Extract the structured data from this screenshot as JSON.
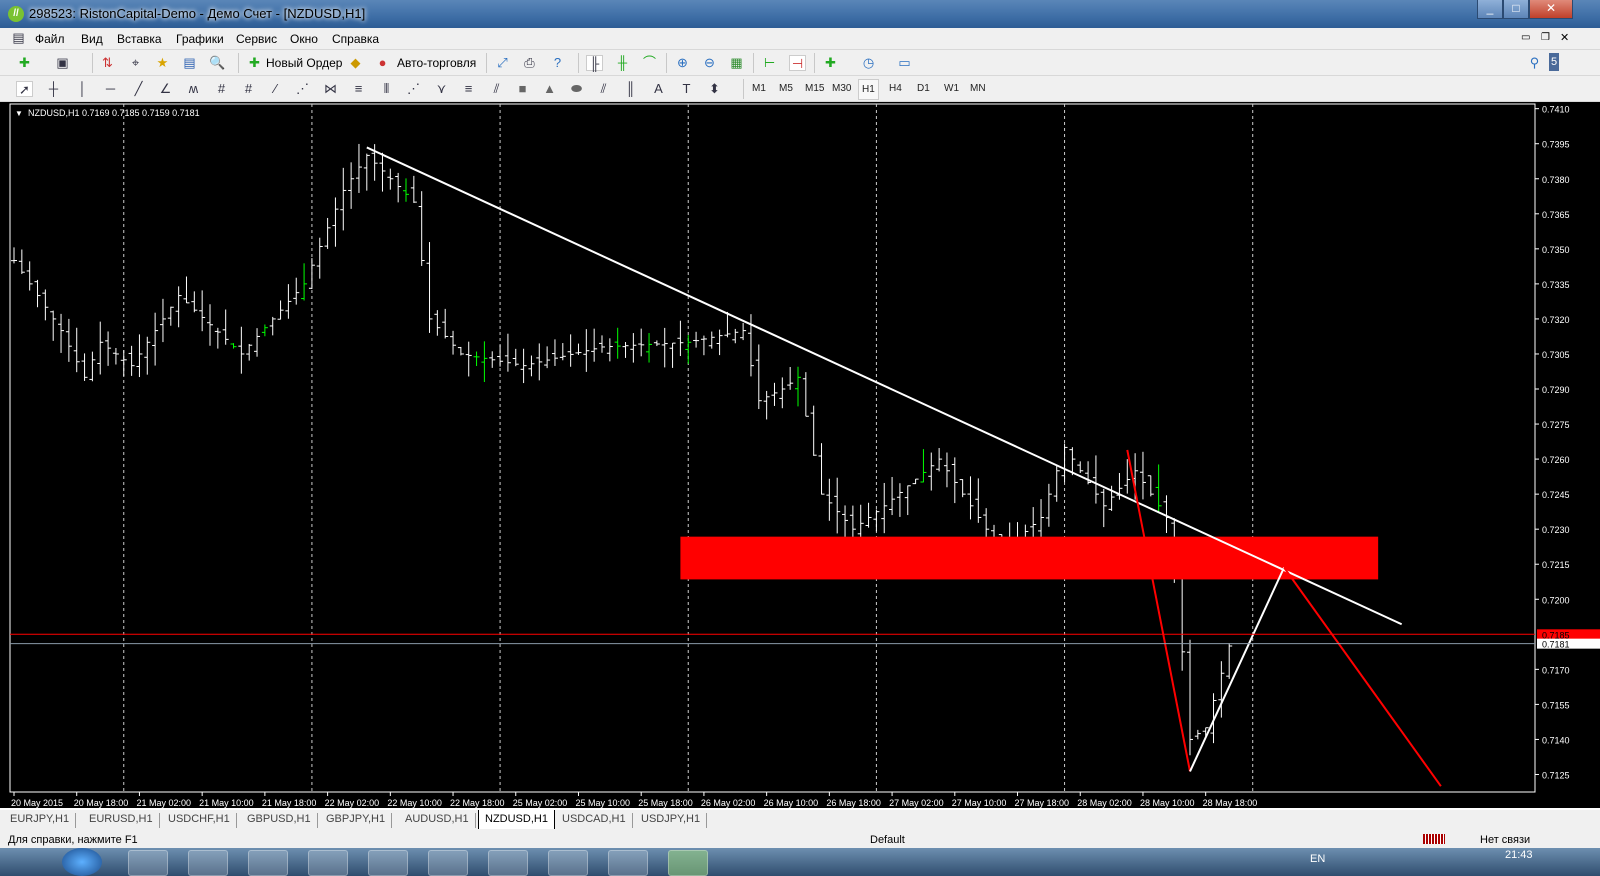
{
  "window": {
    "title": "298523: RistonCapital-Demo - Демо Счет - [NZDUSD,H1]",
    "logo": "MT4",
    "controls": [
      "minimize",
      "maximize",
      "close"
    ]
  },
  "menu": [
    "Файл",
    "Вид",
    "Вставка",
    "Графики",
    "Сервис",
    "Окно",
    "Справка"
  ],
  "toolbar": {
    "new_order": "Новый Ордер",
    "auto_trading": "Авто-торговля",
    "search_placeholder": "",
    "notification_count": "5"
  },
  "timeframes": [
    "M1",
    "M5",
    "M15",
    "M30",
    "H1",
    "H4",
    "D1",
    "W1",
    "MN"
  ],
  "active_timeframe": "H1",
  "drawing_tools": {
    "text_label": "A"
  },
  "chart_data": {
    "type": "ohlc",
    "symbol_info": "NZDUSD,H1  0.7169 0.7185 0.7159 0.7181",
    "ylim": [
      0.71175,
      0.7412
    ],
    "y_ticks": [
      "0.7410",
      "0.7395",
      "0.7380",
      "0.7365",
      "0.7350",
      "0.7335",
      "0.7320",
      "0.7305",
      "0.7290",
      "0.7275",
      "0.7260",
      "0.7245",
      "0.7230",
      "0.7215",
      "0.7200",
      "0.7170",
      "0.7155",
      "0.7140",
      "0.7125"
    ],
    "x_labels": [
      "20 May 2015",
      "20 May 18:00",
      "21 May 02:00",
      "21 May 10:00",
      "21 May 18:00",
      "22 May 02:00",
      "22 May 10:00",
      "22 May 18:00",
      "25 May 02:00",
      "25 May 10:00",
      "25 May 18:00",
      "26 May 02:00",
      "26 May 10:00",
      "26 May 18:00",
      "27 May 02:00",
      "27 May 10:00",
      "27 May 18:00",
      "28 May 02:00",
      "28 May 10:00",
      "28 May 18:00"
    ],
    "x_label_step_bars": 8,
    "day_separator_bars": [
      14,
      38,
      62,
      86,
      110,
      134,
      158
    ],
    "price_path": [
      [
        0,
        0.7345
      ],
      [
        6,
        0.7315
      ],
      [
        9,
        0.7295
      ],
      [
        11,
        0.731
      ],
      [
        15,
        0.73
      ],
      [
        21,
        0.733
      ],
      [
        29,
        0.7305
      ],
      [
        37,
        0.7335
      ],
      [
        42,
        0.7375
      ],
      [
        45,
        0.739
      ],
      [
        51,
        0.737
      ],
      [
        53,
        0.732
      ],
      [
        57,
        0.7305
      ],
      [
        65,
        0.73
      ],
      [
        75,
        0.7308
      ],
      [
        86,
        0.731
      ],
      [
        93,
        0.7315
      ],
      [
        95,
        0.7285
      ],
      [
        98,
        0.729
      ],
      [
        100,
        0.7295
      ],
      [
        103,
        0.7245
      ],
      [
        107,
        0.723
      ],
      [
        111,
        0.724
      ],
      [
        118,
        0.726
      ],
      [
        126,
        0.722
      ],
      [
        131,
        0.7235
      ],
      [
        134,
        0.7265
      ],
      [
        139,
        0.724
      ],
      [
        143,
        0.7255
      ],
      [
        147,
        0.7235
      ],
      [
        148,
        0.7215
      ],
      [
        150,
        0.714
      ],
      [
        152,
        0.7145
      ],
      [
        155,
        0.718
      ]
    ],
    "bid_line": {
      "price": "0.7185",
      "color": "#ff0000"
    },
    "ask_line": {
      "price": "0.7181",
      "color": "#8a9aa8"
    },
    "trendline": {
      "from": [
        45,
        0.73934
      ],
      "to": [
        177,
        0.71893
      ],
      "color": "#ffffff"
    },
    "zone": {
      "from_bar": 85,
      "to_bar": 174,
      "top": 0.72268,
      "bottom": 0.72085,
      "color": "#ff0000"
    },
    "zigzag": [
      {
        "from": [
          142,
          0.72639
        ],
        "to": [
          150,
          0.71263
        ],
        "color": "#ff0000"
      },
      {
        "from": [
          150,
          0.71263
        ],
        "to": [
          162,
          0.72136
        ],
        "color": "#ffffff"
      },
      {
        "from": [
          162,
          0.72136
        ],
        "to": [
          182,
          0.712
        ],
        "color": "#ff0000"
      }
    ]
  },
  "tabs": [
    "EURJPY,H1",
    "EURUSD,H1",
    "USDCHF,H1",
    "GBPUSD,H1",
    "GBPJPY,H1",
    "AUDUSD,H1",
    "NZDUSD,H1",
    "USDCAD,H1",
    "USDJPY,H1"
  ],
  "active_tab": "NZDUSD,H1",
  "status": {
    "help": "Для справки, нажмите F1",
    "profile": "Default",
    "connection": "Нет связи"
  },
  "taskbar": {
    "lang": "EN",
    "clock": "21:43"
  }
}
